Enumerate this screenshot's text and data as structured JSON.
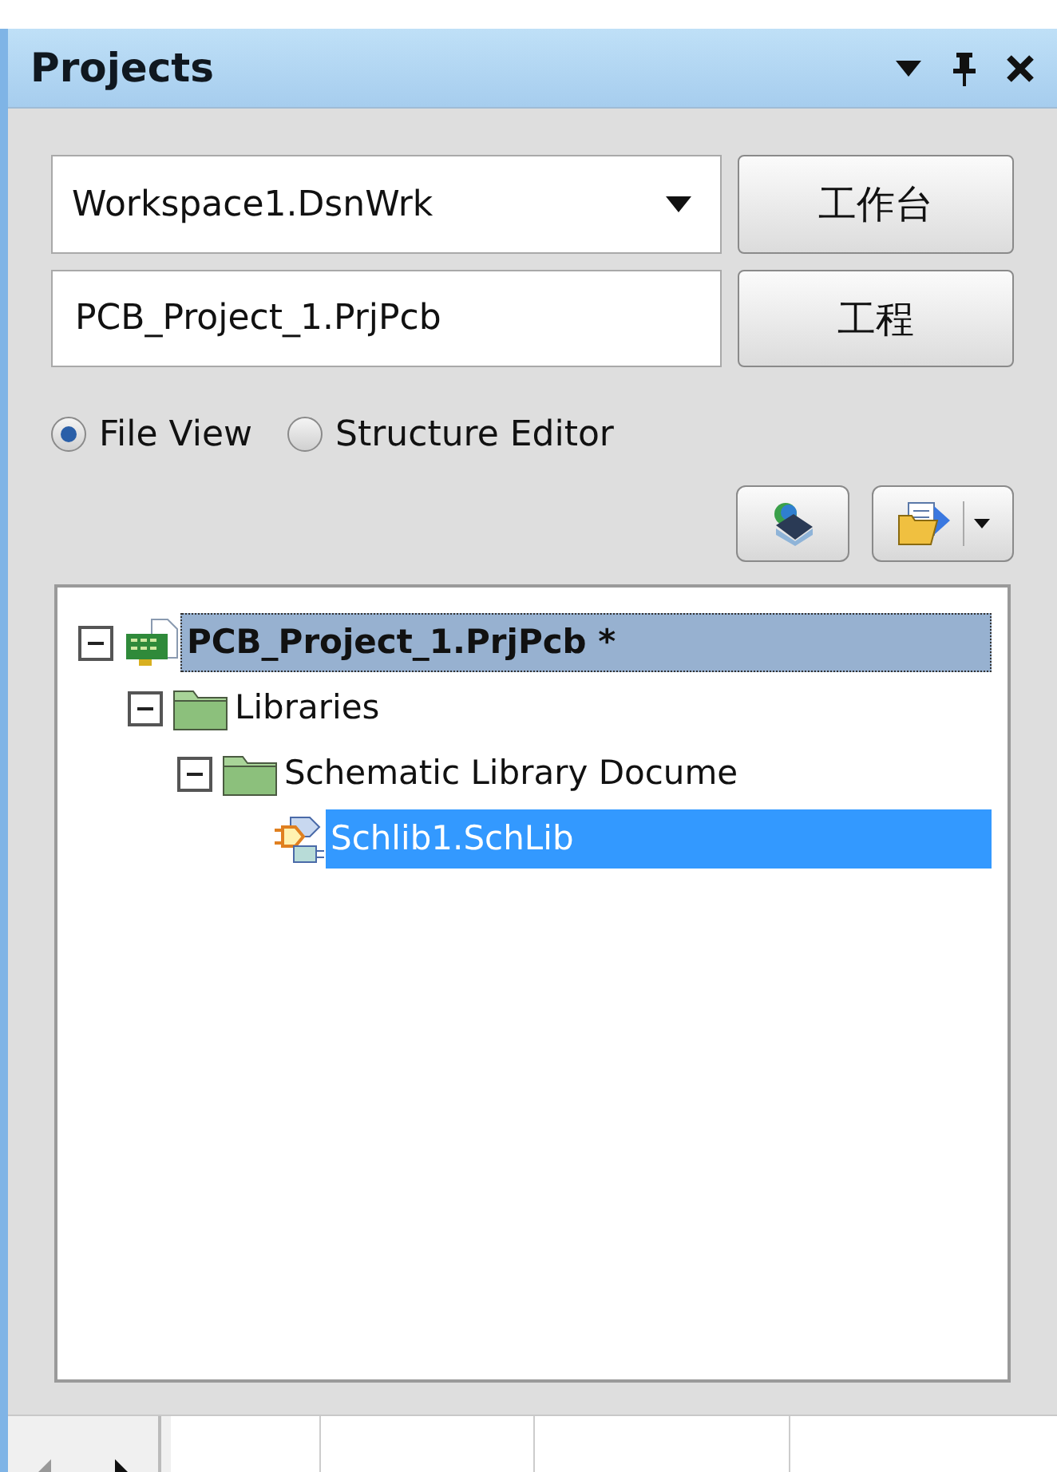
{
  "panel": {
    "title": "Projects"
  },
  "workspace": {
    "value": "Workspace1.DsnWrk",
    "button": "工作台"
  },
  "project": {
    "value": "PCB_Project_1.PrjPcb",
    "button": "工程"
  },
  "views": [
    {
      "label": "File View",
      "selected": true
    },
    {
      "label": "Structure Editor",
      "selected": false
    }
  ],
  "tree": [
    {
      "label": "PCB_Project_1.PrjPcb *",
      "kind": "project",
      "expanded": true,
      "focused": true,
      "selected": false,
      "children": [
        {
          "label": "Libraries",
          "kind": "folder",
          "expanded": true,
          "focused": false,
          "selected": false,
          "children": [
            {
              "label": "Schematic Library Docume",
              "kind": "folder",
              "expanded": true,
              "focused": false,
              "selected": false,
              "children": [
                {
                  "label": "Schlib1.SchLib",
                  "kind": "schlib",
                  "focused": false,
                  "selected": true
                }
              ]
            }
          ]
        }
      ]
    }
  ]
}
